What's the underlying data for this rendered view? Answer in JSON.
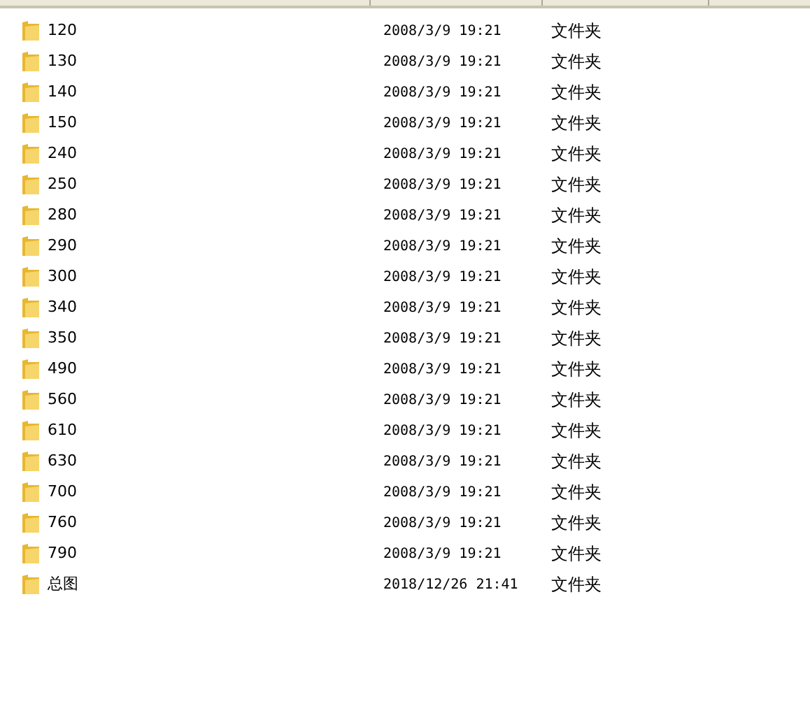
{
  "files": [
    {
      "name": "120",
      "modified": "2008/3/9 19:21",
      "type": "文件夹"
    },
    {
      "name": "130",
      "modified": "2008/3/9 19:21",
      "type": "文件夹"
    },
    {
      "name": "140",
      "modified": "2008/3/9 19:21",
      "type": "文件夹"
    },
    {
      "name": "150",
      "modified": "2008/3/9 19:21",
      "type": "文件夹"
    },
    {
      "name": "240",
      "modified": "2008/3/9 19:21",
      "type": "文件夹"
    },
    {
      "name": "250",
      "modified": "2008/3/9 19:21",
      "type": "文件夹"
    },
    {
      "name": "280",
      "modified": "2008/3/9 19:21",
      "type": "文件夹"
    },
    {
      "name": "290",
      "modified": "2008/3/9 19:21",
      "type": "文件夹"
    },
    {
      "name": "300",
      "modified": "2008/3/9 19:21",
      "type": "文件夹"
    },
    {
      "name": "340",
      "modified": "2008/3/9 19:21",
      "type": "文件夹"
    },
    {
      "name": "350",
      "modified": "2008/3/9 19:21",
      "type": "文件夹"
    },
    {
      "name": "490",
      "modified": "2008/3/9 19:21",
      "type": "文件夹"
    },
    {
      "name": "560",
      "modified": "2008/3/9 19:21",
      "type": "文件夹"
    },
    {
      "name": "610",
      "modified": "2008/3/9 19:21",
      "type": "文件夹"
    },
    {
      "name": "630",
      "modified": "2008/3/9 19:21",
      "type": "文件夹"
    },
    {
      "name": "700",
      "modified": "2008/3/9 19:21",
      "type": "文件夹"
    },
    {
      "name": "760",
      "modified": "2008/3/9 19:21",
      "type": "文件夹"
    },
    {
      "name": "790",
      "modified": "2008/3/9 19:21",
      "type": "文件夹"
    },
    {
      "name": "总图",
      "modified": "2018/12/26 21:41",
      "type": "文件夹"
    }
  ]
}
